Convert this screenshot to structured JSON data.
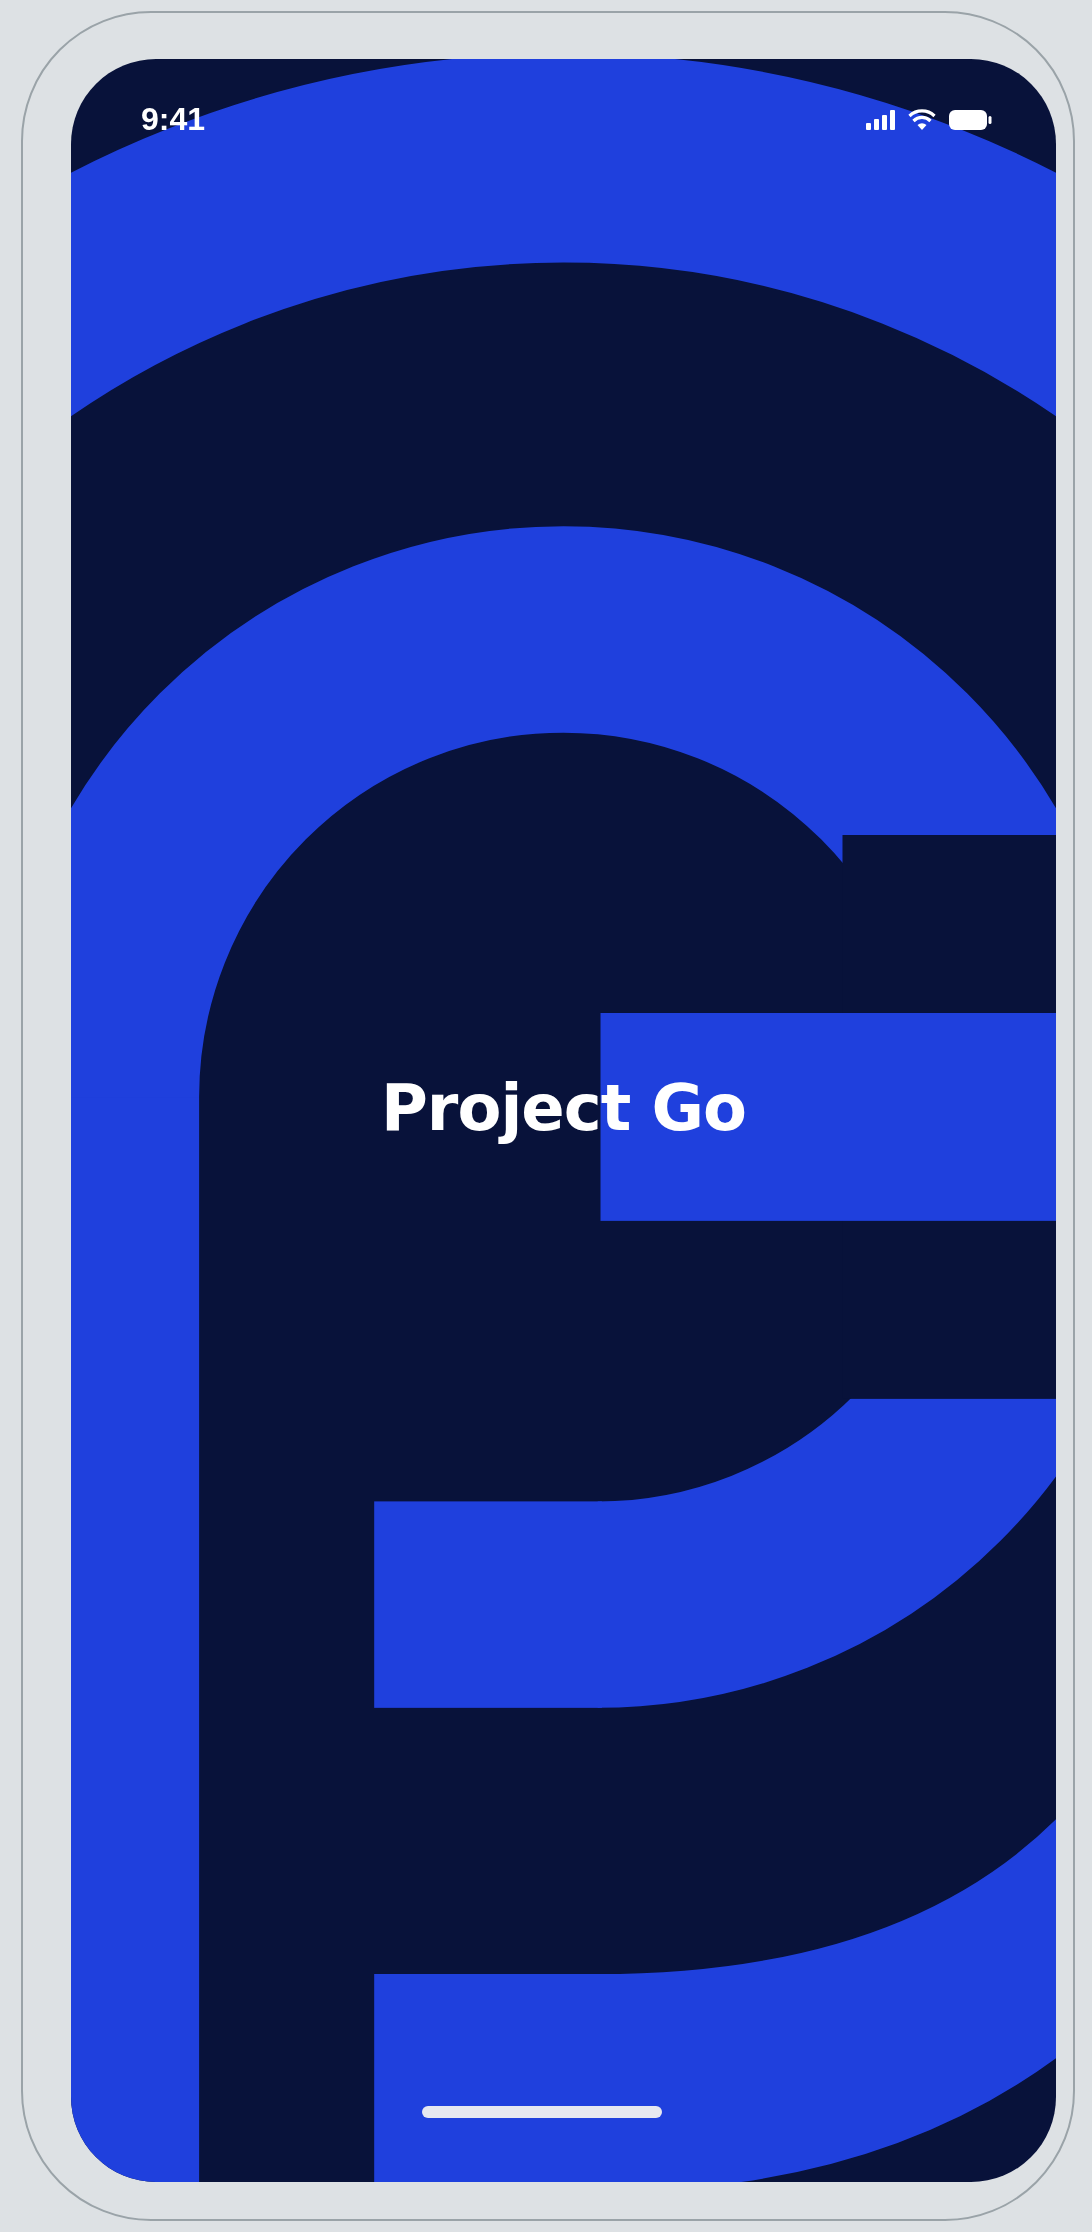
{
  "status_bar": {
    "time": "9:41"
  },
  "splash": {
    "title": "Project Go"
  }
}
